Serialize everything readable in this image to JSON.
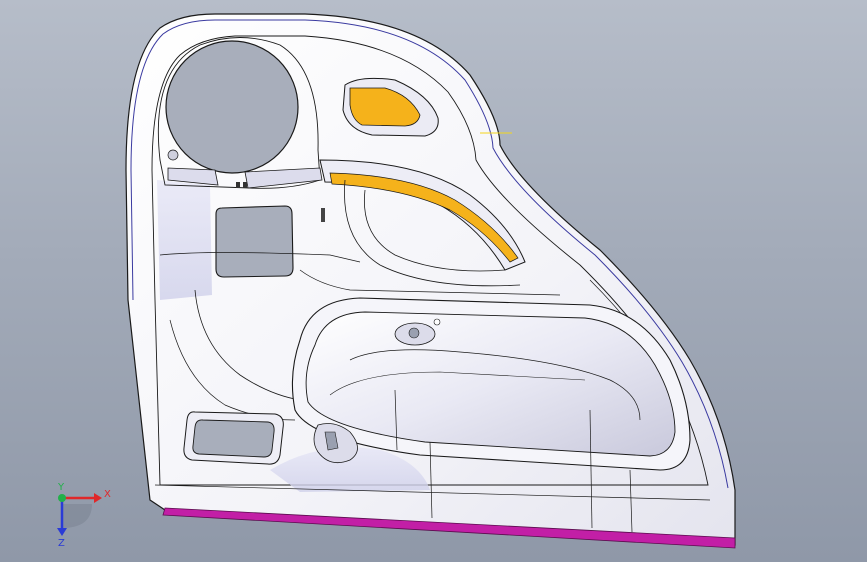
{
  "viewport": {
    "background_top": "#b6bdc9",
    "background_bottom": "#8f98a8"
  },
  "model": {
    "body_color": "#f4f4f8",
    "edge_color": "#1a1a1a",
    "highlight_color": "#f5b21b",
    "base_strip_color": "#c21fa6",
    "silhouette_color": "#3a3aa0"
  },
  "triad": {
    "x_label": "X",
    "y_label": "Y",
    "z_label": "Z",
    "x_color": "#e0282a",
    "y_color": "#22b04a",
    "z_color": "#2a3bd6"
  }
}
